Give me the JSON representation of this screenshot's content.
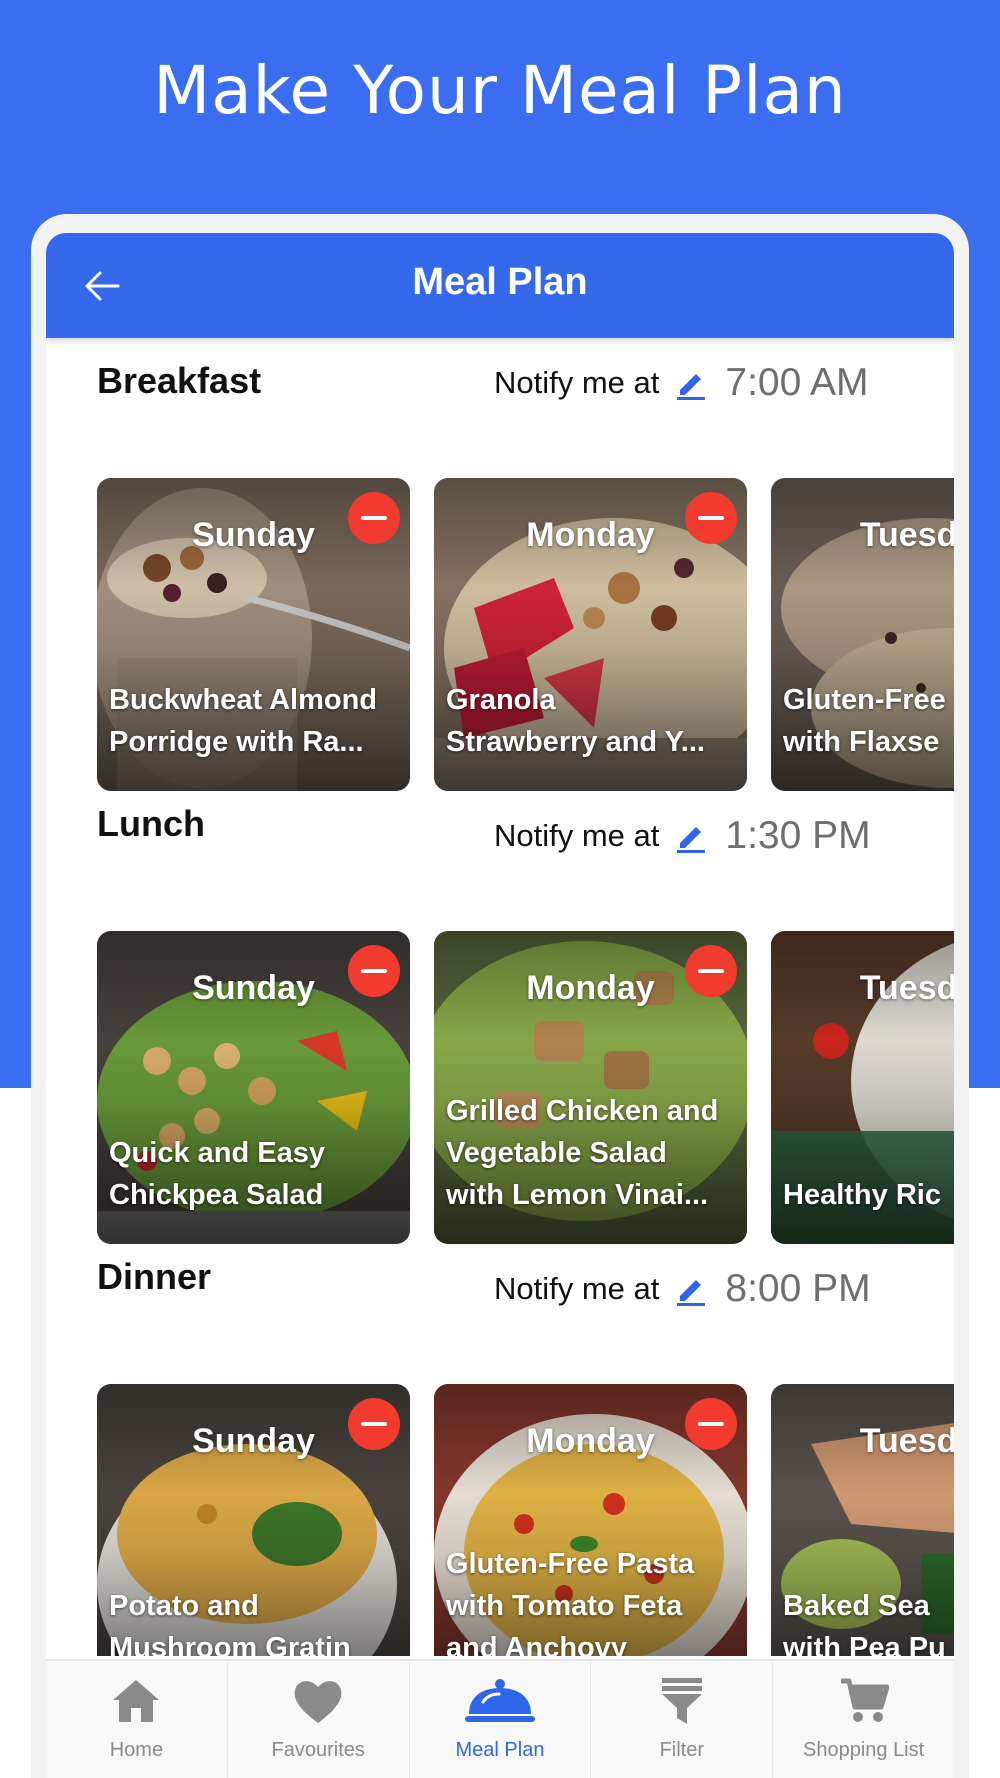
{
  "promo": {
    "title": "Make Your Meal Plan"
  },
  "appbar": {
    "title": "Meal Plan",
    "back_icon": "arrow-left-icon"
  },
  "colors": {
    "primary": "#3469ec",
    "remove": "#f23b2f",
    "promo_bg": "#3a6df0"
  },
  "sections": [
    {
      "title": "Breakfast",
      "notify_label": "Notify me at",
      "time": "7:00 AM",
      "cards": [
        {
          "day": "Sunday",
          "dish": "Buckwheat Almond\nPorridge with Ra..."
        },
        {
          "day": "Monday",
          "dish": "Granola\nStrawberry and Y..."
        },
        {
          "day": "Tuesday",
          "dish": "Gluten-Free\nwith Flaxse"
        }
      ]
    },
    {
      "title": "Lunch",
      "notify_label": "Notify me at",
      "time": "1:30 PM",
      "cards": [
        {
          "day": "Sunday",
          "dish": "Quick and Easy\nChickpea Salad"
        },
        {
          "day": "Monday",
          "dish": "Grilled Chicken and\nVegetable Salad\nwith Lemon Vinai..."
        },
        {
          "day": "Tuesday",
          "dish": "Healthy Ric"
        }
      ]
    },
    {
      "title": "Dinner",
      "notify_label": "Notify me at",
      "time": "8:00 PM",
      "cards": [
        {
          "day": "Sunday",
          "dish": "Potato and\nMushroom Gratin"
        },
        {
          "day": "Monday",
          "dish": "Gluten-Free Pasta\nwith Tomato Feta\nand Anchovy"
        },
        {
          "day": "Tuesday",
          "dish": "Baked Sea\nwith Pea Pu"
        }
      ]
    }
  ],
  "bottom_nav": [
    {
      "label": "Home",
      "icon": "home-icon",
      "active": false
    },
    {
      "label": "Favourites",
      "icon": "heart-icon",
      "active": false
    },
    {
      "label": "Meal Plan",
      "icon": "cloche-icon",
      "active": true
    },
    {
      "label": "Filter",
      "icon": "filter-icon",
      "active": false
    },
    {
      "label": "Shopping List",
      "icon": "cart-icon",
      "active": false
    }
  ]
}
